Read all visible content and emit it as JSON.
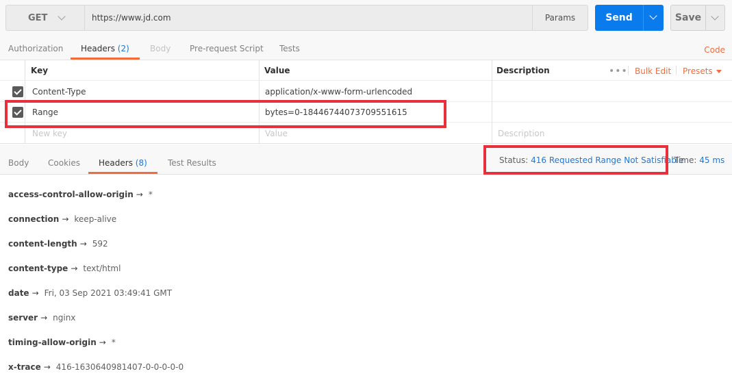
{
  "request": {
    "method": "GET",
    "url": "https://www.jd.com",
    "params_label": "Params",
    "send_label": "Send",
    "save_label": "Save"
  },
  "request_tabs": [
    {
      "label": "Authorization",
      "count": "",
      "state": "normal"
    },
    {
      "label": "Headers",
      "count": "(2)",
      "state": "active"
    },
    {
      "label": "Body",
      "count": "",
      "state": "disabled"
    },
    {
      "label": "Pre-request Script",
      "count": "",
      "state": "normal"
    },
    {
      "label": "Tests",
      "count": "",
      "state": "normal"
    }
  ],
  "code_link": "Code",
  "headers_table": {
    "columns": [
      "Key",
      "Value",
      "Description"
    ],
    "actions": {
      "bulk_edit": "Bulk Edit",
      "presets": "Presets",
      "more": "•••"
    },
    "rows": [
      {
        "checked": true,
        "key": "Content-Type",
        "value": "application/x-www-form-urlencoded",
        "description": ""
      },
      {
        "checked": true,
        "key": "Range",
        "value": "bytes=0-18446744073709551615",
        "description": ""
      }
    ],
    "new_row": {
      "key_placeholder": "New key",
      "value_placeholder": "Value",
      "description_placeholder": "Description"
    }
  },
  "response_tabs": [
    {
      "label": "Body",
      "count": "",
      "state": "normal"
    },
    {
      "label": "Cookies",
      "count": "",
      "state": "normal"
    },
    {
      "label": "Headers",
      "count": "(8)",
      "state": "active"
    },
    {
      "label": "Test Results",
      "count": "",
      "state": "normal"
    }
  ],
  "response_status": {
    "status_label": "Status:",
    "status_value": "416 Requested Range Not Satisfiable",
    "time_label": "Time:",
    "time_value": "45 ms"
  },
  "response_headers": [
    {
      "key": "access-control-allow-origin",
      "value": "*"
    },
    {
      "key": "connection",
      "value": "keep-alive"
    },
    {
      "key": "content-length",
      "value": "592"
    },
    {
      "key": "content-type",
      "value": "text/html"
    },
    {
      "key": "date",
      "value": "Fri, 03 Sep 2021 03:49:41 GMT"
    },
    {
      "key": "server",
      "value": "nginx"
    },
    {
      "key": "timing-allow-origin",
      "value": "*"
    },
    {
      "key": "x-trace",
      "value": "416-1630640981407-0-0-0-0-0"
    }
  ],
  "colors": {
    "accent": "#f26b3a",
    "send": "#097bed",
    "link": "#1e78d6",
    "highlight": "#e8303a"
  }
}
